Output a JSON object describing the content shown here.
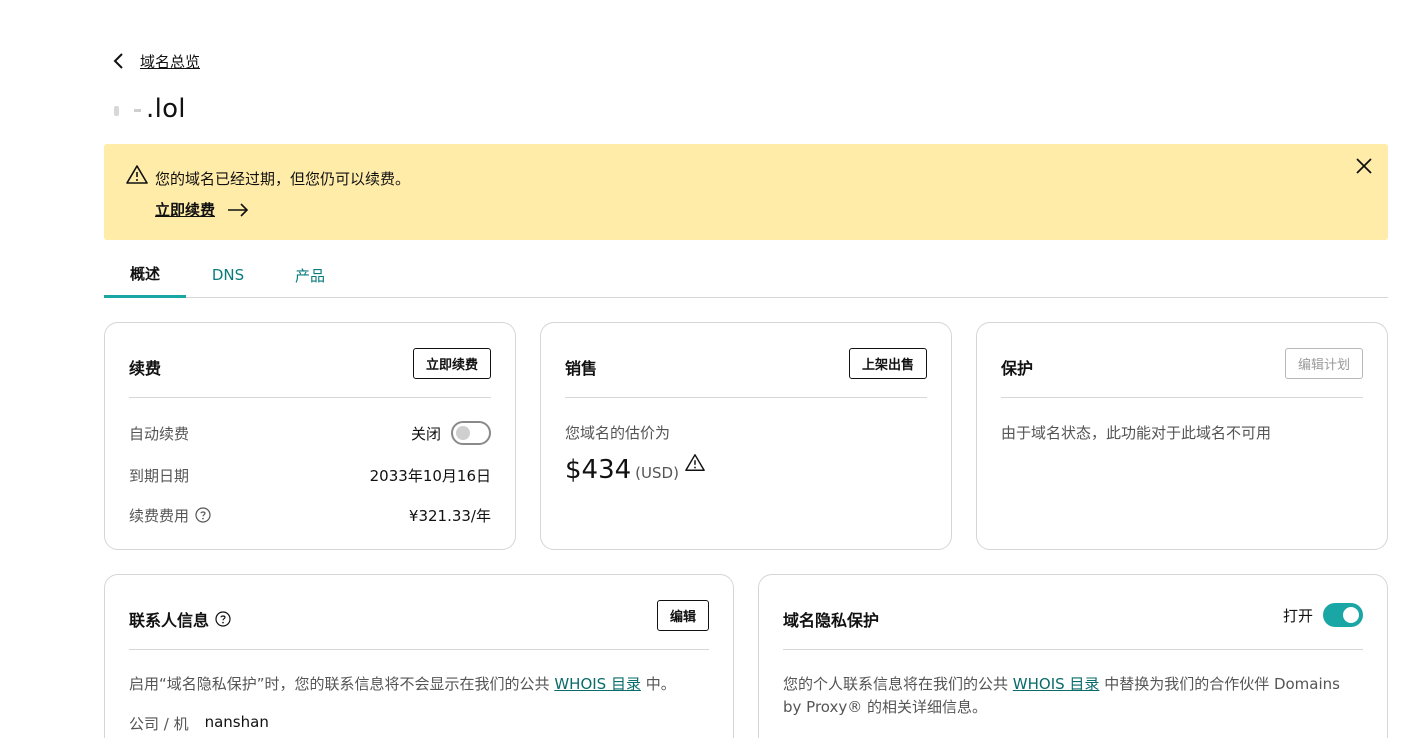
{
  "header": {
    "back_label": "域名总览",
    "domain_suffix": ".lol"
  },
  "alert": {
    "message": "您的域名已经过期，但您仍可以续费。",
    "link_label": "立即续费",
    "bg_color": "#ffeca9"
  },
  "tabs": [
    {
      "label": "概述"
    },
    {
      "label": "DNS"
    },
    {
      "label": "产品"
    }
  ],
  "renewal": {
    "title": "续费",
    "button": "立即续费",
    "auto_renew_label": "自动续费",
    "auto_renew_value": "关闭",
    "expiry_label": "到期日期",
    "expiry_value": "2033年10月16日",
    "fee_label": "续费费用",
    "fee_value": "¥321.33/年"
  },
  "sale": {
    "title": "销售",
    "button": "上架出售",
    "estimate_label": "您域名的估价为",
    "amount": "$434",
    "currency": "(USD)"
  },
  "protection": {
    "title": "保护",
    "button": "编辑计划",
    "message": "由于域名状态，此功能对于此域名不可用"
  },
  "contact": {
    "title": "联系人信息",
    "button": "编辑",
    "desc_before": "启用“域名隐私保护”时，您的联系信息将不会显示在我们的公共 ",
    "desc_link": "WHOIS 目录",
    "desc_after": " 中。",
    "company_label": "公司 / 机",
    "company_value": "nanshan"
  },
  "privacy": {
    "title": "域名隐私保护",
    "status": "打开",
    "desc_before": "您的个人联系信息将在我们的公共 ",
    "desc_link": "WHOIS 目录",
    "desc_after": " 中替换为我们的合作伙伴 Domains by Proxy® 的相关详细信息。"
  },
  "colors": {
    "accent": "#1ba6a6",
    "link": "#0a6b6b",
    "border": "#d6d6d6"
  }
}
